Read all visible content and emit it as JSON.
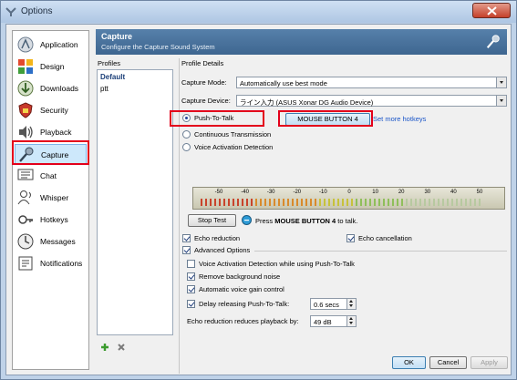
{
  "window": {
    "title": "Options"
  },
  "nav": {
    "items": [
      {
        "label": "Application",
        "icon": "application-icon"
      },
      {
        "label": "Design",
        "icon": "design-icon"
      },
      {
        "label": "Downloads",
        "icon": "downloads-icon"
      },
      {
        "label": "Security",
        "icon": "security-icon"
      },
      {
        "label": "Playback",
        "icon": "playback-icon"
      },
      {
        "label": "Capture",
        "icon": "microphone-icon",
        "selected": true
      },
      {
        "label": "Chat",
        "icon": "chat-icon"
      },
      {
        "label": "Whisper",
        "icon": "whisper-icon"
      },
      {
        "label": "Hotkeys",
        "icon": "hotkeys-icon"
      },
      {
        "label": "Messages",
        "icon": "messages-icon"
      },
      {
        "label": "Notifications",
        "icon": "notifications-icon"
      }
    ]
  },
  "header": {
    "title": "Capture",
    "subtitle": "Configure the Capture Sound System",
    "icon": "microphone-icon"
  },
  "profiles": {
    "heading": "Profiles",
    "items": [
      "Default",
      "ptt"
    ],
    "selected": "Default",
    "add_icon": "plus-icon",
    "remove_icon": "x-icon"
  },
  "details": {
    "heading": "Profile Details",
    "capture_mode_label": "Capture Mode:",
    "capture_mode_value": "Automatically use best mode",
    "capture_device_label": "Capture Device:",
    "capture_device_value": "ライン入力 (ASUS Xonar DG Audio Device)",
    "radio_ptt": "Push-To-Talk",
    "radio_continuous": "Continuous Transmission",
    "radio_vad": "Voice Activation Detection",
    "selected_radio": "Push-To-Talk",
    "hotkey_button": "MOUSE BUTTON 4",
    "more_hotkeys": "Set more hotkeys",
    "meter_ticks": [
      "-50",
      "-40",
      "-30",
      "-20",
      "-10",
      "0",
      "10",
      "20",
      "30",
      "40",
      "50"
    ],
    "stop_test": "Stop Test",
    "press_prefix": "Press ",
    "press_key": "MOUSE BUTTON 4",
    "press_suffix": " to talk.",
    "echo_reduction": "Echo reduction",
    "echo_cancellation": "Echo cancellation",
    "advanced_options": "Advanced Options",
    "vad_while_ptt": "Voice Activation Detection while using Push-To-Talk",
    "remove_noise": "Remove background noise",
    "auto_gain": "Automatic voice gain control",
    "delay_release": "Delay releasing Push-To-Talk:",
    "delay_value": "0.6 secs",
    "echo_reduces_label": "Echo reduction reduces playback by:",
    "echo_reduces_value": "49 dB"
  },
  "footer": {
    "ok": "OK",
    "cancel": "Cancel",
    "apply": "Apply"
  },
  "colors": {
    "highlight_red": "#e3001b",
    "header_blue": "#4a739c",
    "link_blue": "#1a55c8"
  }
}
